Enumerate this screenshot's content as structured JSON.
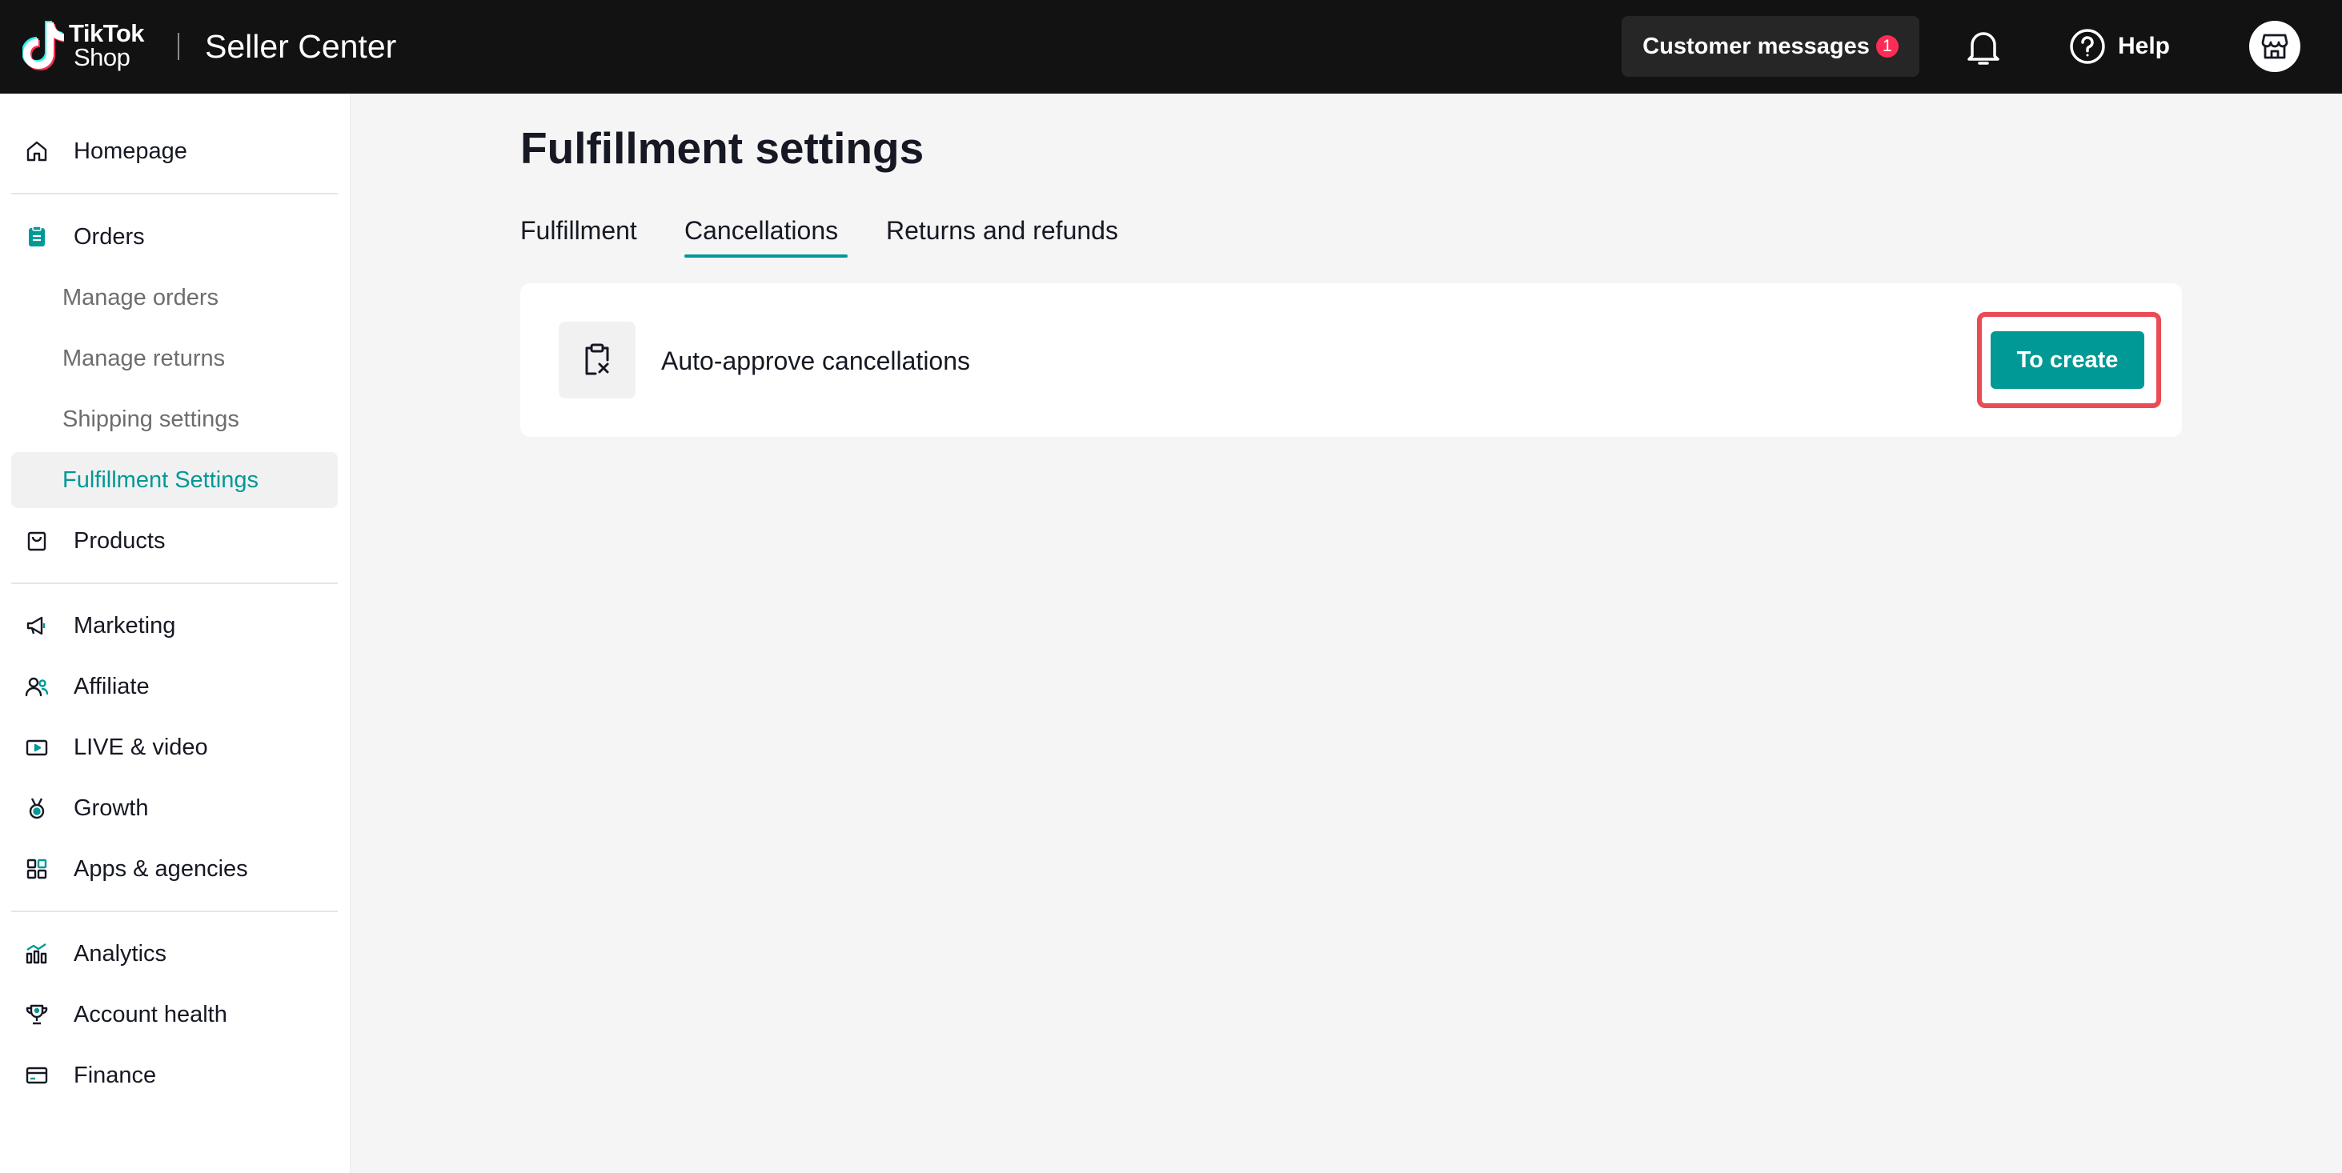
{
  "header": {
    "logo_line1": "TikTok",
    "logo_line2": "Shop",
    "app_title": "Seller Center",
    "messages_label": "Customer messages",
    "messages_count": "1",
    "help_label": "Help"
  },
  "sidebar": {
    "items": [
      {
        "label": "Homepage",
        "icon": "home-icon"
      },
      {
        "label": "Orders",
        "icon": "clipboard-icon"
      },
      {
        "label": "Manage orders"
      },
      {
        "label": "Manage returns"
      },
      {
        "label": "Shipping settings"
      },
      {
        "label": "Fulfillment Settings",
        "active": true
      },
      {
        "label": "Products",
        "icon": "bag-icon"
      },
      {
        "label": "Marketing",
        "icon": "megaphone-icon"
      },
      {
        "label": "Affiliate",
        "icon": "people-icon"
      },
      {
        "label": "LIVE & video",
        "icon": "video-icon"
      },
      {
        "label": "Growth",
        "icon": "medal-icon"
      },
      {
        "label": "Apps & agencies",
        "icon": "apps-grid-icon"
      },
      {
        "label": "Analytics",
        "icon": "bar-chart-icon"
      },
      {
        "label": "Account health",
        "icon": "trophy-icon"
      },
      {
        "label": "Finance",
        "icon": "card-icon"
      }
    ]
  },
  "main": {
    "title": "Fulfillment settings",
    "tabs": [
      {
        "label": "Fulfillment"
      },
      {
        "label": "Cancellations",
        "active": true
      },
      {
        "label": "Returns and refunds"
      }
    ],
    "card": {
      "label": "Auto-approve cancellations",
      "button_label": "To create"
    }
  },
  "colors": {
    "accent": "#009995",
    "topbar": "#121212",
    "highlight": "#ea4b54",
    "badge": "#fe2c55"
  }
}
